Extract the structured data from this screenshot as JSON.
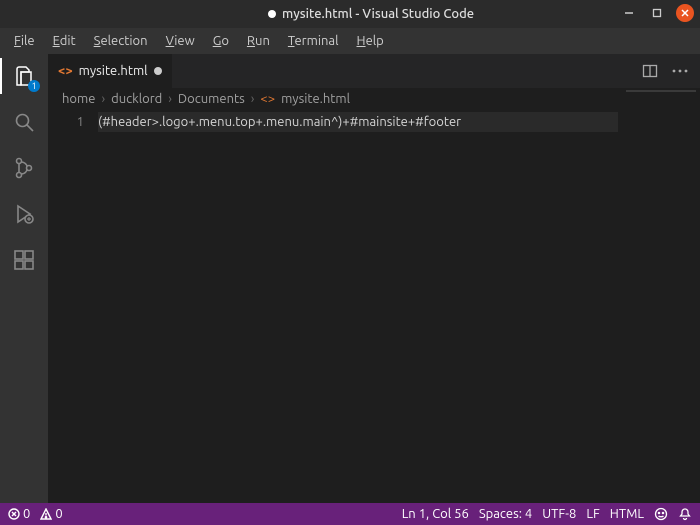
{
  "titlebar": {
    "title": "mysite.html - Visual Studio Code"
  },
  "menu": {
    "file": "File",
    "edit": "Edit",
    "selection": "Selection",
    "view": "View",
    "go": "Go",
    "run": "Run",
    "terminal": "Terminal",
    "help": "Help"
  },
  "activity": {
    "explorer_badge": "1"
  },
  "tab": {
    "filename": "mysite.html"
  },
  "breadcrumbs": {
    "seg0": "home",
    "seg1": "ducklord",
    "seg2": "Documents",
    "seg3": "mysite.html"
  },
  "editor": {
    "line_no": "1",
    "line": "(#header>.logo+.menu.top+.menu.main^)+#mainsite+#footer"
  },
  "status": {
    "errors": "0",
    "warnings": "0",
    "cursor": "Ln 1, Col 56",
    "spaces": "Spaces: 4",
    "encoding": "UTF-8",
    "eol": "LF",
    "lang": "HTML",
    "feedback": ""
  }
}
